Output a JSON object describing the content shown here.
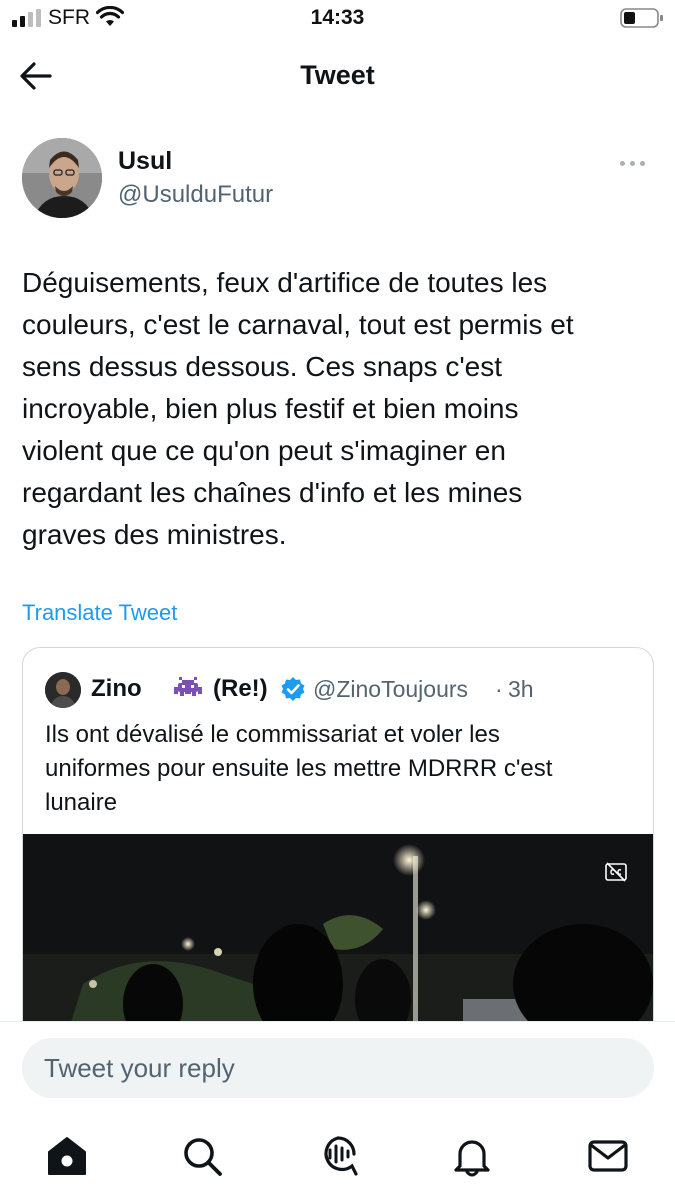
{
  "status_bar": {
    "carrier": "SFR",
    "time": "14:33"
  },
  "nav": {
    "title": "Tweet"
  },
  "tweet": {
    "author_name": "Usul",
    "author_handle": "@UsulduFutur",
    "text_lines": [
      "Déguisements, feux d'artifice de toutes les",
      "couleurs, c'est le carnaval, tout est permis et",
      "sens dessus dessous. Ces snaps c'est",
      "incroyable, bien plus festif et bien moins",
      "violent que ce qu'on peut s'imaginer en",
      "regardant les chaînes d'info et les mines",
      "graves des ministres."
    ],
    "translate_label": "Translate Tweet"
  },
  "quote": {
    "name": "Zino",
    "name_suffix": "(Re!)",
    "handle": "@ZinoToujours",
    "separator": "·",
    "time": "3h",
    "text_lines": [
      "Ils ont dévalisé le commissariat et voler les",
      "uniformes pour ensuite les mettre MDRRR c'est",
      "lunaire"
    ]
  },
  "reply": {
    "placeholder": "Tweet your reply"
  },
  "colors": {
    "link": "#1d9bf0",
    "verified": "#1d9bf0",
    "secondary_text": "#536471",
    "alien_emoji": "#7b4fb8"
  },
  "icons": {
    "back": "arrow-left-icon",
    "more": "more-horizontal-icon",
    "verified": "verified-badge-icon",
    "cc": "closed-captions-icon",
    "tabs": [
      "home-icon",
      "search-icon",
      "spaces-icon",
      "notifications-icon",
      "messages-icon"
    ]
  }
}
